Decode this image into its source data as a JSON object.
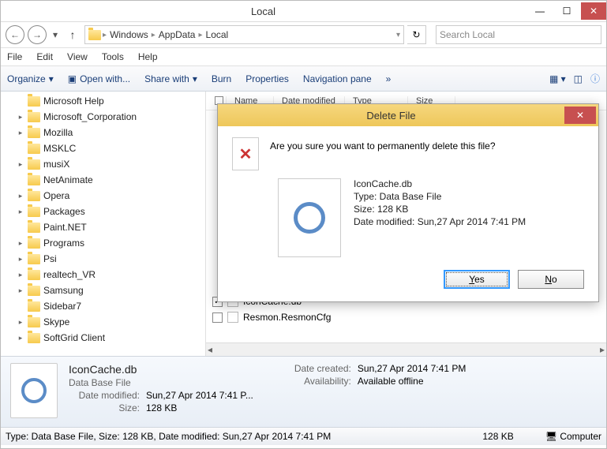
{
  "window": {
    "title": "Local"
  },
  "nav": {
    "path": [
      "Windows",
      "AppData",
      "Local"
    ],
    "search_placeholder": "Search Local"
  },
  "menubar": [
    "File",
    "Edit",
    "View",
    "Tools",
    "Help"
  ],
  "toolbar": {
    "organize": "Organize",
    "open_with": "Open with...",
    "share_with": "Share with",
    "burn": "Burn",
    "properties": "Properties",
    "navigation_pane": "Navigation pane"
  },
  "columns": {
    "name": "Name",
    "date": "Date modified",
    "type": "Type",
    "size": "Size"
  },
  "tree": [
    {
      "label": "Microsoft Help",
      "exp": ""
    },
    {
      "label": "Microsoft_Corporation",
      "exp": "+"
    },
    {
      "label": "Mozilla",
      "exp": "+"
    },
    {
      "label": "MSKLC",
      "exp": ""
    },
    {
      "label": "musiX",
      "exp": "+"
    },
    {
      "label": "NetAnimate",
      "exp": ""
    },
    {
      "label": "Opera",
      "exp": "+"
    },
    {
      "label": "Packages",
      "exp": "+"
    },
    {
      "label": "Paint.NET",
      "exp": ""
    },
    {
      "label": "Programs",
      "exp": "+"
    },
    {
      "label": "Psi",
      "exp": "+"
    },
    {
      "label": "realtech_VR",
      "exp": "+"
    },
    {
      "label": "Samsung",
      "exp": "+"
    },
    {
      "label": "Sidebar7",
      "exp": ""
    },
    {
      "label": "Skype",
      "exp": "+"
    },
    {
      "label": "SoftGrid Client",
      "exp": "+"
    }
  ],
  "files": [
    {
      "name": "IconCache.db",
      "checked": true
    },
    {
      "name": "Resmon.ResmonCfg",
      "checked": false
    }
  ],
  "details": {
    "filename": "IconCache.db",
    "filetype": "Data Base File",
    "date_modified_label": "Date modified:",
    "date_modified": "Sun,27 Apr 2014 7:41 P...",
    "size_label": "Size:",
    "size": "128 KB",
    "date_created_label": "Date created:",
    "date_created": "Sun,27 Apr 2014 7:41 PM",
    "availability_label": "Availability:",
    "availability": "Available offline"
  },
  "statusbar": {
    "left": "Type: Data Base File, Size: 128 KB, Date modified: Sun,27 Apr 2014 7:41 PM",
    "size": "128 KB",
    "computer": "Computer"
  },
  "dialog": {
    "title": "Delete File",
    "question": "Are you sure you want to permanently delete this file?",
    "filename": "IconCache.db",
    "type_label": "Type: Data Base File",
    "size_label": "Size: 128 KB",
    "date_label": "Date modified: Sun,27 Apr 2014 7:41 PM",
    "yes": "Yes",
    "no": "No"
  }
}
